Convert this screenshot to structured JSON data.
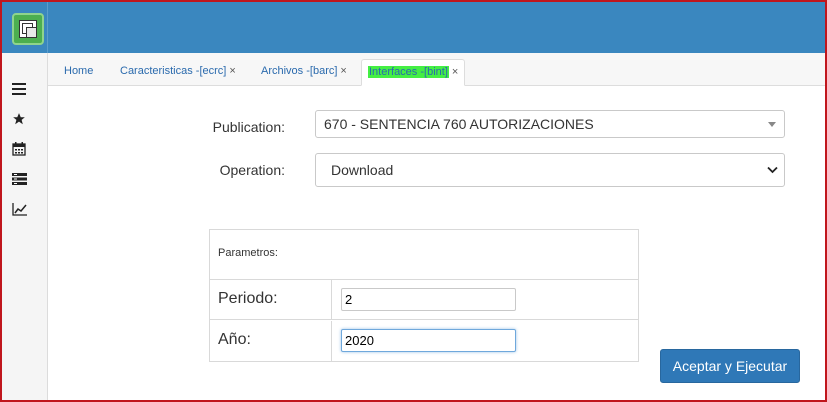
{
  "tabs": [
    {
      "label": "Home",
      "closable": false
    },
    {
      "label": "Caracteristicas -[ecrc]",
      "closable": true
    },
    {
      "label": "Archivos -[barc]",
      "closable": true
    },
    {
      "label": "Interfaces -[bint]",
      "closable": true
    }
  ],
  "close_glyph": "×",
  "form": {
    "publication_label": "Publication:",
    "publication_value": "670 - SENTENCIA 760 AUTORIZACIONES",
    "operation_label": "Operation:",
    "operation_value": "Download"
  },
  "params": {
    "header": "Parametros:",
    "periodo_label": "Periodo:",
    "periodo_value": "2",
    "anio_label": "Año:",
    "anio_value": "2020"
  },
  "submit_label": "Aceptar y Ejecutar",
  "sidebar_icons": [
    "menu-icon",
    "star-icon",
    "calendar-icon",
    "list-icon",
    "chart-icon"
  ],
  "colors": {
    "topbar": "#3a87bf",
    "accent": "#2f78b7",
    "active_tab_highlight": "#44ef44",
    "frame_border": "#c0161d"
  }
}
